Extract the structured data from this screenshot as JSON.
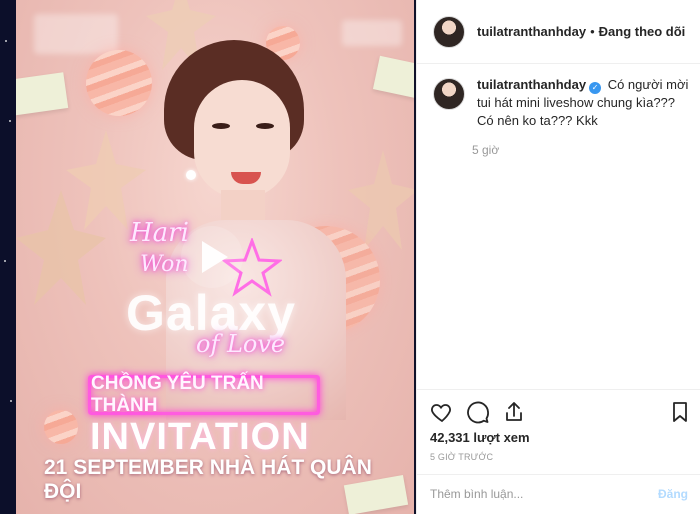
{
  "post": {
    "media": {
      "script_name_top": "Hari",
      "script_name_bottom": "Won",
      "title": "Galaxy",
      "script_subtitle": "of Love",
      "highlight": "CHỒNG YÊU TRẤN THÀNH",
      "invitation": "INVITATION",
      "date_line": "21 SEPTEMBER NHÀ HÁT QUÂN ĐỘI"
    },
    "header": {
      "username": "tuilatranthanhday",
      "separator": "•",
      "follow_status": "Đang theo dõi"
    },
    "caption": {
      "username": "tuilatranthanhday",
      "text": "Có người mời tui hát mini liveshow chung kìa??? Có nên ko ta??? Kkk",
      "time": "5 giờ"
    },
    "stats": {
      "views": "42,331 lượt xem",
      "posted": "5 GIỜ TRƯỚC"
    },
    "comment": {
      "placeholder": "Thêm bình luận...",
      "post_label": "Đăng"
    },
    "icons": {
      "like": "heart-icon",
      "comment": "comment-icon",
      "share": "share-icon",
      "save": "bookmark-icon",
      "play": "play-icon",
      "verified": "verified-badge-icon"
    },
    "colors": {
      "verified": "#3897f0",
      "neon": "#ff4fd8",
      "post_disabled": "#b3dbff",
      "muted": "#999999"
    }
  }
}
